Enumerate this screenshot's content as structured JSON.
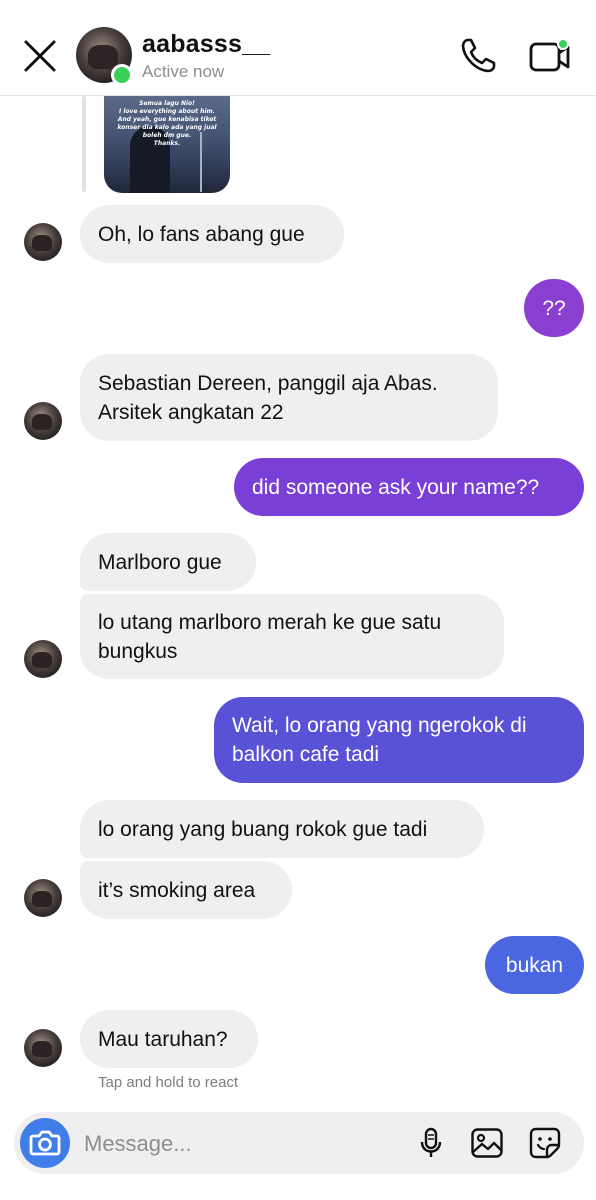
{
  "header": {
    "username": "aabasss__",
    "status": "Active now"
  },
  "shared_post": {
    "caption": "Semua lagu Nio!\nI love everything about him.\nAnd yeah, gue kenabisa tiket konser dia kalo ada yang jual boleh dm gue.\nThanks."
  },
  "messages": [
    {
      "from": "them",
      "text": "Oh, lo fans abang gue"
    },
    {
      "from": "me",
      "text": "??"
    },
    {
      "from": "them",
      "text": "Sebastian Dereen, panggil aja Abas. Arsitek angkatan 22"
    },
    {
      "from": "me",
      "text": "did someone ask your name??"
    },
    {
      "from": "them",
      "text": "Marlboro gue"
    },
    {
      "from": "them",
      "text": "lo utang marlboro merah ke gue satu bungkus"
    },
    {
      "from": "me",
      "text": "Wait, lo orang yang ngerokok di balkon cafe tadi"
    },
    {
      "from": "them",
      "text": "lo orang yang buang rokok gue tadi"
    },
    {
      "from": "them",
      "text": "it’s smoking area"
    },
    {
      "from": "me",
      "text": "bukan"
    },
    {
      "from": "them",
      "text": "Mau taruhan?"
    }
  ],
  "hint": "Tap and hold to react",
  "composer": {
    "placeholder": "Message..."
  },
  "colors": {
    "online": "#3ad15a",
    "received_bubble": "#efefef",
    "sent_gradient": [
      "#8a3fd0",
      "#7a3fd6",
      "#5a52d6",
      "#4a66e0"
    ],
    "camera_button": "#3f7ee8"
  },
  "icons": [
    "close-icon",
    "phone-icon",
    "video-call-icon",
    "camera-icon",
    "microphone-icon",
    "gallery-icon",
    "sticker-icon"
  ]
}
